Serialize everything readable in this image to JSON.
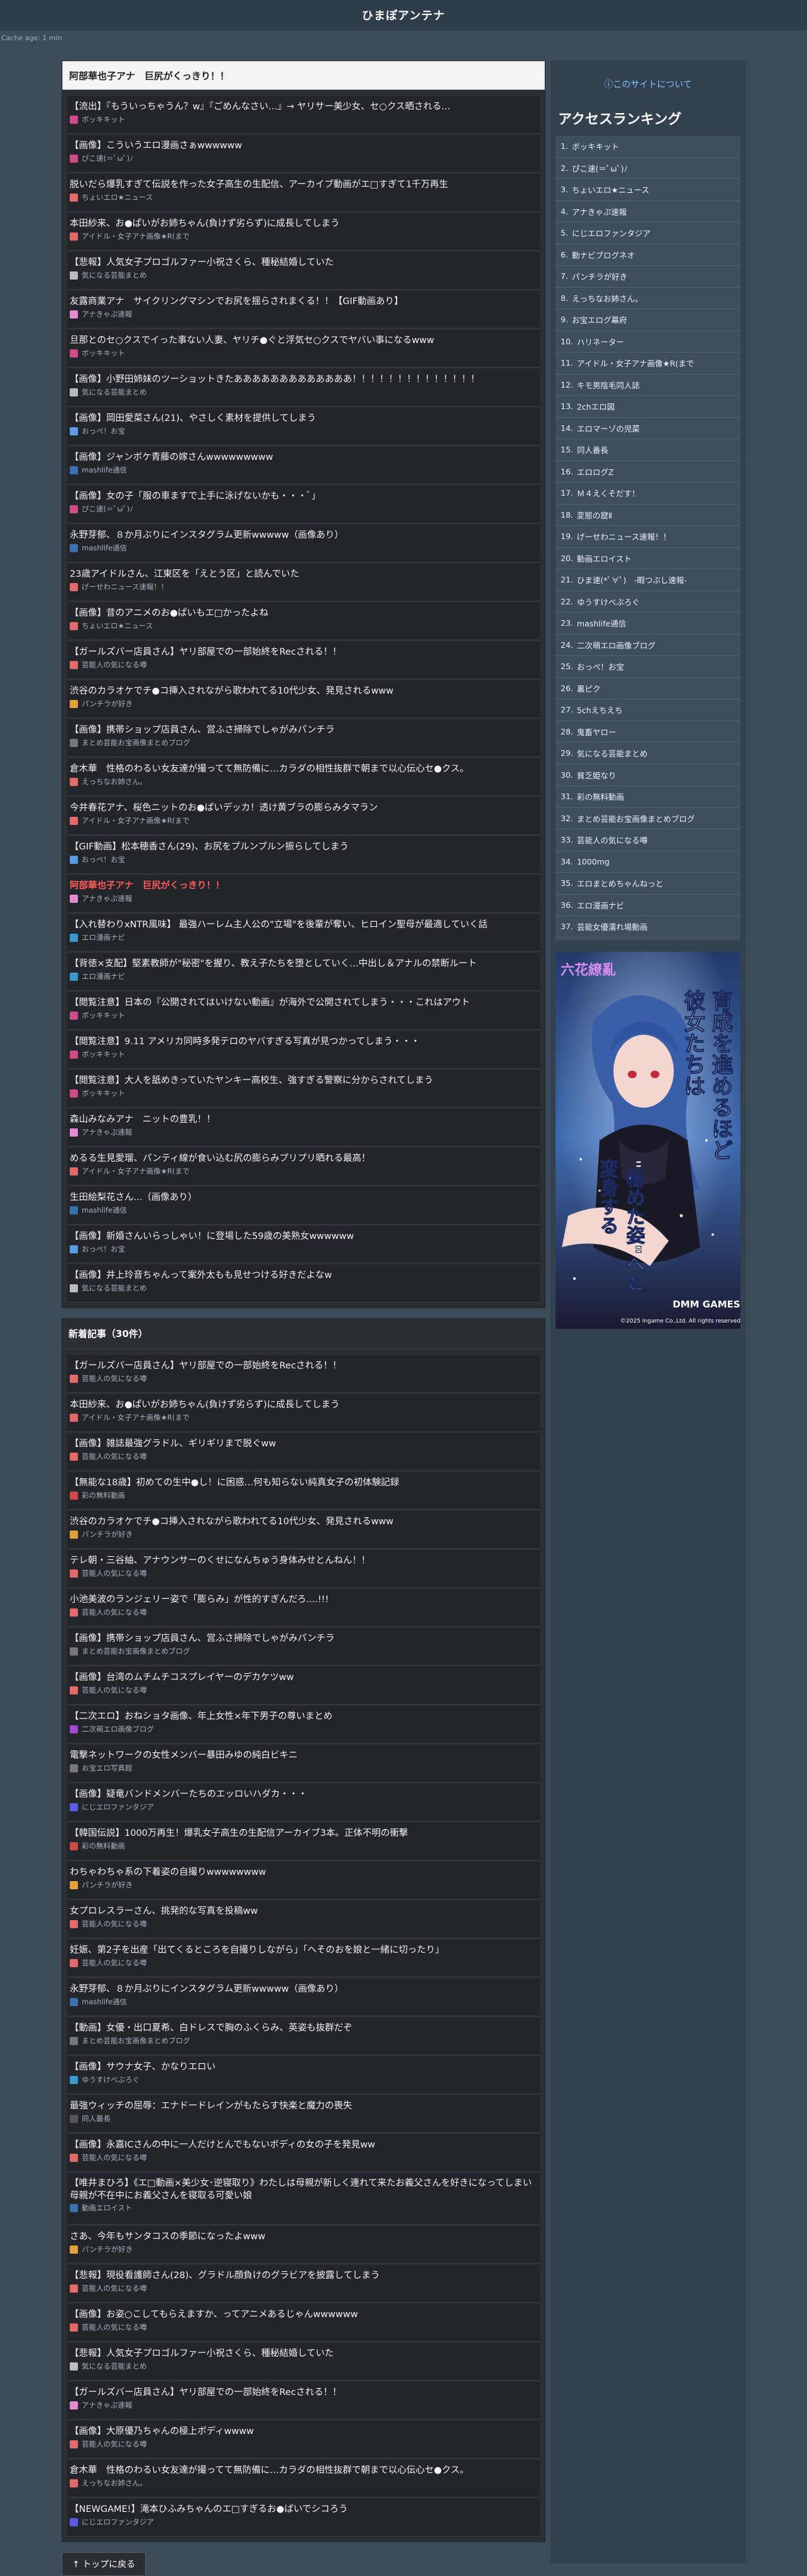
{
  "header": {
    "site_title": "ひまぽアンテナ",
    "cache": "Cache age: 1 min"
  },
  "featured": {
    "title": "阿部華也子アナ　巨尻がくっきり！！",
    "items": [
      {
        "t": "【流出】『もういっちゃうん？w』『ごめんなさい…』→ ヤリサー美少女、セ○クス晒される...",
        "s": "ボッキキット",
        "c": "#d04a8a"
      },
      {
        "t": "【画像】こういうエロ漫画さぁwwwwww",
        "s": "ぴこ速(＝ﾟωﾟ)ﾉ",
        "c": "#d04a8a"
      },
      {
        "t": "脱いだら爆乳すぎて伝説を作った女子高生の生配信、アーカイブ動画がエ□すぎて1千万再生",
        "s": "ちょいエロ★ニュース",
        "c": "#e46a6a"
      },
      {
        "t": "本田紗来、お●ぱいがお姉ちゃん(負けず劣らず)に成長してしまう",
        "s": "アイドル・女子アナ画像★R(まで",
        "c": "#e46a6a"
      },
      {
        "t": "【悲報】人気女子プロゴルファー小祝さくら、種秘結婚していた",
        "s": "気になる芸能まとめ",
        "c": "#bbbbbb"
      },
      {
        "t": "友露商業アナ　サイクリングマシンでお尻を揺らされまくる！！【GIF動画あり】",
        "s": "アナきゃぷ速報",
        "c": "#e48ad0"
      },
      {
        "t": "旦那とのセ○クスでイった事ない人妻、ヤリチ●ぐと浮気セ○クスでヤバい事になるwww",
        "s": "ボッキキット",
        "c": "#d04a8a"
      },
      {
        "t": "【画像】小野田姉妹のツーショットきたあああああああああああああ！！！！！！！！！！！！！！",
        "s": "気になる芸能まとめ",
        "c": "#bbbbbb"
      },
      {
        "t": "【画像】岡田愛菜さん(21)、やさしく素材を提供してしまう",
        "s": "おっぺ！お宝",
        "c": "#5a9be8"
      },
      {
        "t": "【画像】ジャンボケ青藤の嫁さんwwwwwwwww",
        "s": "mashlife通信",
        "c": "#3a6fb0"
      },
      {
        "t": "【画像】女の子「服の車ますで上手に泳げないかも・・・ﾞ」",
        "s": "ぴこ速(＝ﾟωﾟ)ﾉ",
        "c": "#d04a8a"
      },
      {
        "t": "永野芽郁、８か月ぶりにインスタグラム更新wwwww（画像あり）",
        "s": "mashlife通信",
        "c": "#3a6fb0"
      },
      {
        "t": "23歳アイドルさん、江東区を「えとう区」と読んでいた",
        "s": "げーせわニュース速報！！",
        "c": "#e46a6a"
      },
      {
        "t": "【画像】昔のアニメのお●ぱいもエ□かったよね",
        "s": "ちょいエロ★ニュース",
        "c": "#e46a6a"
      },
      {
        "t": "【ガールズバー店員さん】ヤリ部屋での一部始終をRecされる！！",
        "s": "芸能人の気になる噂",
        "c": "#e46a6a"
      },
      {
        "t": "渋谷のカラオケでチ●コ挿入されながら歌われてる10代少女、発見されるwww",
        "s": "パンチラが好き",
        "c": "#e4a03a"
      },
      {
        "t": "【画像】携帯ショップ店員さん、営ふさ掃除でしゃがみパンチラ",
        "s": "まとめ芸能お宝画像まとめブログ",
        "c": "#777777"
      },
      {
        "t": "倉木華　性格のわるい女友達が撮ってて無防備に…カラダの相性抜群で朝まで以心伝心セ●クス。",
        "s": "えっちなお姉さん。",
        "c": "#e46a6a"
      },
      {
        "t": "今井春花アナ、桜色ニットのお●ぱいデッカ！透け黄ブラの膨らみタマラン",
        "s": "アイドル・女子アナ画像★R(まで",
        "c": "#e46a6a"
      },
      {
        "t": "【GIF動画】松本穂香さん(29)、お尻をプルンプルン振らしてしまう",
        "s": "おっぺ！お宝",
        "c": "#5a9be8"
      },
      {
        "t": "阿部華也子アナ　巨尻がくっきり！！",
        "s": "アナきゃぷ速報",
        "c": "#e48ad0",
        "red": true
      },
      {
        "t": "【入れ替わりxNTR風味】 最強ハーレム主人公の\"立場\"を後輩が奪い、ヒロイン聖母が最適していく話",
        "s": "エロ漫画ナビ",
        "c": "#3a9ad0"
      },
      {
        "t": "【背徳×支配】堅素教師が\"秘密\"を握り、教え子たちを堕としていく…中出し＆アナルの禁断ルート",
        "s": "エロ漫画ナビ",
        "c": "#3a9ad0"
      },
      {
        "t": "【閲覧注意】日本の『公開されてはいけない動画』が海外で公開されてしまう・・・これはアウト",
        "s": "ボッキキット",
        "c": "#d04a8a"
      },
      {
        "t": "【閲覧注意】9.11 アメリカ同時多発テロのヤバすぎる写真が見つかってしまう・・・",
        "s": "ボッキキット",
        "c": "#d04a8a"
      },
      {
        "t": "【閲覧注意】大人を舐めきっていたヤンキー高校生、強すぎる警察に分からされてしまう",
        "s": "ボッキキット",
        "c": "#d04a8a"
      },
      {
        "t": "森山みなみアナ　ニットの豊乳！！",
        "s": "アナきゃぷ速報",
        "c": "#e48ad0"
      },
      {
        "t": "めるる生見愛瑠、パンティ線が食い込む尻の膨らみプリプリ晒れる最高！",
        "s": "アイドル・女子アナ画像★R(まで",
        "c": "#e46a6a"
      },
      {
        "t": "生田絵梨花さん...（画像あり）",
        "s": "mashlife通信",
        "c": "#3a6fb0"
      },
      {
        "t": "【画像】新婚さんいらっしゃい！に登場した59歳の美熟女wwwwww",
        "s": "おっぺ！お宝",
        "c": "#5a9be8"
      },
      {
        "t": "【画像】井上玲音ちゃんって案外太もも見せつける好きだよなw",
        "s": "気になる芸能まとめ",
        "c": "#bbbbbb"
      }
    ]
  },
  "latest": {
    "title": "新着記事（30件）",
    "items": [
      {
        "t": "【ガールズバー店員さん】ヤリ部屋での一部始終をRecされる！！",
        "s": "芸能人の気になる噂",
        "c": "#e46a6a"
      },
      {
        "t": "本田紗来、お●ぱいがお姉ちゃん(負けず劣らず)に成長してしまう",
        "s": "アイドル・女子アナ画像★R(まで",
        "c": "#e46a6a"
      },
      {
        "t": "【画像】雑誌最強グラドル、ギリギリまで脱ぐww",
        "s": "芸能人の気になる噂",
        "c": "#e46a6a"
      },
      {
        "t": "【無能な18歳】初めての生中●し！に困惑…何も知らない純真女子の初体験記録",
        "s": "彩の無料動画",
        "c": "#d04a4a"
      },
      {
        "t": "渋谷のカラオケでチ●コ挿入されながら歌われてる10代少女、発見されるwww",
        "s": "パンチラが好き",
        "c": "#e4a03a"
      },
      {
        "t": "テレ朝・三谷紬、アナウンサーのくせになんちゅう身体みせとんねん！！",
        "s": "芸能人の気になる噂",
        "c": "#e46a6a"
      },
      {
        "t": "小池美波のランジェリー姿で「膨らみ」が性的すぎんだろ....!!!",
        "s": "芸能人の気になる噂",
        "c": "#e46a6a"
      },
      {
        "t": "【画像】携帯ショップ店員さん、営ふさ掃除でしゃがみパンチラ",
        "s": "まとめ芸能お宝画像まとめブログ",
        "c": "#777777"
      },
      {
        "t": "【画像】台湾のムチムチコスプレイヤーのデカケツww",
        "s": "芸能人の気になる噂",
        "c": "#e46a6a"
      },
      {
        "t": "【二次エロ】おねショタ画像、年上女性×年下男子の尊いまとめ",
        "s": "二次萌エロ画像ブログ",
        "c": "#a04ad0"
      },
      {
        "t": "電撃ネットワークの女性メンバー暴田みゆの純白ビキニ",
        "s": "お宝エロ写真館",
        "c": "#777777"
      },
      {
        "t": "【画像】疑竜バンドメンバーたちのエッロいハダカ・・・",
        "s": "にじエロファンタジア",
        "c": "#5a5ae8"
      },
      {
        "t": "【韓国伝説】1000万再生！爆乳女子高生の生配信アーカイブ3本。正体不明の衝撃",
        "s": "彩の無料動画",
        "c": "#d04a4a"
      },
      {
        "t": "わちゃわちゃ系の下着姿の自撮りwwwwwwww",
        "s": "パンチラが好き",
        "c": "#e4a03a"
      },
      {
        "t": "女プロレスラーさん、挑発的な写真を投稿ww",
        "s": "芸能人の気になる噂",
        "c": "#e46a6a"
      },
      {
        "t": "妊娠、第2子を出産「出てくるところを自撮りしながら」「ヘそのおを娘と一緒に切ったり」",
        "s": "芸能人の気になる噂",
        "c": "#e46a6a"
      },
      {
        "t": "永野芽郁、８か月ぶりにインスタグラム更新wwwww（画像あり）",
        "s": "mashlife通信",
        "c": "#3a6fb0"
      },
      {
        "t": "【動画】女優・出口夏希、白ドレスで胸のふくらみ、英姿も抜群だぞ",
        "s": "まとめ芸能お宝画像まとめブログ",
        "c": "#777777"
      },
      {
        "t": "【画像】サウナ女子、かなりエロい",
        "s": "ゆうすけべぶろぐ",
        "c": "#3a9ad0"
      },
      {
        "t": "最強ウィッチの屈辱：エナドードレインがもたらす快楽と魔力の喪失",
        "s": "同人最長",
        "c": "#555555"
      },
      {
        "t": "【画像】永嘉ICさんの中に一人だけとんでもないボディの女の子を発見ww",
        "s": "芸能人の気になる噂",
        "c": "#e46a6a"
      },
      {
        "t": "【唯井まひろ】《エ□動画×美少女･逆寝取り》わたしは母親が新しく連れて来たお義父さんを好きになってしまい母親が不在中にお義父さんを寝取る可愛い娘",
        "s": "動画エロイスト",
        "c": "#3a6fb0",
        "tall": true
      },
      {
        "t": "さあ、今年もサンタコスの季節になったよwww",
        "s": "パンチラが好き",
        "c": "#e4a03a"
      },
      {
        "t": "【悲報】現役看護師さん(28)、グラドル顔負けのグラビアを披露してしまう",
        "s": "芸能人の気になる噂",
        "c": "#e46a6a"
      },
      {
        "t": "【画像】お姿○こしてもらえますか、ってアニメあるじゃんwwwwww",
        "s": "芸能人の気になる噂",
        "c": "#e46a6a"
      },
      {
        "t": "【悲報】人気女子プロゴルファー小祝さくら、種秘結婚していた",
        "s": "気になる芸能まとめ",
        "c": "#bbbbbb"
      },
      {
        "t": "【ガールズバー店員さん】ヤリ部屋での一部始終をRecされる！！",
        "s": "アナきゃぷ速報",
        "c": "#e48ad0"
      },
      {
        "t": "【画像】大原優乃ちゃんの極上ボディwwww",
        "s": "芸能人の気になる噂",
        "c": "#e46a6a"
      },
      {
        "t": "倉木華　性格のわるい女友達が撮ってて無防備に…カラダの相性抜群で朝まで以心伝心セ●クス。",
        "s": "えっちなお姉さん。",
        "c": "#e46a6a"
      },
      {
        "t": "【NEWGAME!】滝本ひふみちゃんのエ□すぎるお●ぱいでシコろう",
        "s": "にじエロファンタジア",
        "c": "#5a5ae8"
      }
    ]
  },
  "totop": "↑ トップに戻る",
  "sidebar": {
    "about_link": "このサイトについて",
    "ranking_title": "アクセスランキング",
    "ranking": [
      "ボッキキット",
      "ぴこ速(＝ﾟωﾟ)ﾉ",
      "ちょいエロ★ニュース",
      "アナきゃぷ速報",
      "にじエロファンタジア",
      "動ナビブログネオ",
      "パンチラが好き",
      "えっちなお姉さん。",
      "お宝エログ幕府",
      "ハリネーター",
      "アイドル・女子アナ画像★R(まで",
      "キモ男陰毛同人誌",
      "2chエロ図",
      "エロマーゾの児菜",
      "同人番長",
      "エロログZ",
      "Ｍ４えくそだす！",
      "変態の窟Ⅱ",
      "げーせわニュース速報！！",
      "動画エロイスト",
      "ひま速(*ﾟ∀ﾟ)　-暇つぶし速報-",
      "ゆうすけべぶろぐ",
      "mashlife通信",
      "二次萌エロ画像ブログ",
      "おっぺ！お宝",
      "裏ピク",
      "5chえちえち",
      "鬼畜ヤロー",
      "気になる芸能まとめ",
      "貧乏姫なり",
      "彩の無料動画",
      "まとめ芸能お宝画像まとめブログ",
      "芸能人の気になる噂",
      "1000mg",
      "エロまとめちゃんねっと",
      "エロ漫画ナビ",
      "芸能女優濡れ場動画"
    ],
    "ad": {
      "line1": "育成を進めるほど",
      "line2": "彼女たちは",
      "line3": "\"秘めた姿\"へと",
      "line4": "変身する",
      "brand": "DMM GAMES",
      "copyright": "©2025 Ingame Co.,Ltd. All rights reserved.",
      "corner": "六花繚亂",
      "accent": "#d68cf0"
    }
  }
}
